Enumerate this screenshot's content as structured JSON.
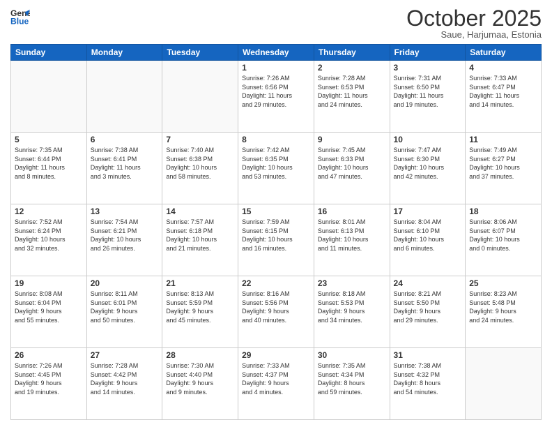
{
  "header": {
    "logo_line1": "General",
    "logo_line2": "Blue",
    "month": "October 2025",
    "location": "Saue, Harjumaa, Estonia"
  },
  "weekdays": [
    "Sunday",
    "Monday",
    "Tuesday",
    "Wednesday",
    "Thursday",
    "Friday",
    "Saturday"
  ],
  "weeks": [
    [
      {
        "day": "",
        "info": ""
      },
      {
        "day": "",
        "info": ""
      },
      {
        "day": "",
        "info": ""
      },
      {
        "day": "1",
        "info": "Sunrise: 7:26 AM\nSunset: 6:56 PM\nDaylight: 11 hours\nand 29 minutes."
      },
      {
        "day": "2",
        "info": "Sunrise: 7:28 AM\nSunset: 6:53 PM\nDaylight: 11 hours\nand 24 minutes."
      },
      {
        "day": "3",
        "info": "Sunrise: 7:31 AM\nSunset: 6:50 PM\nDaylight: 11 hours\nand 19 minutes."
      },
      {
        "day": "4",
        "info": "Sunrise: 7:33 AM\nSunset: 6:47 PM\nDaylight: 11 hours\nand 14 minutes."
      }
    ],
    [
      {
        "day": "5",
        "info": "Sunrise: 7:35 AM\nSunset: 6:44 PM\nDaylight: 11 hours\nand 8 minutes."
      },
      {
        "day": "6",
        "info": "Sunrise: 7:38 AM\nSunset: 6:41 PM\nDaylight: 11 hours\nand 3 minutes."
      },
      {
        "day": "7",
        "info": "Sunrise: 7:40 AM\nSunset: 6:38 PM\nDaylight: 10 hours\nand 58 minutes."
      },
      {
        "day": "8",
        "info": "Sunrise: 7:42 AM\nSunset: 6:35 PM\nDaylight: 10 hours\nand 53 minutes."
      },
      {
        "day": "9",
        "info": "Sunrise: 7:45 AM\nSunset: 6:33 PM\nDaylight: 10 hours\nand 47 minutes."
      },
      {
        "day": "10",
        "info": "Sunrise: 7:47 AM\nSunset: 6:30 PM\nDaylight: 10 hours\nand 42 minutes."
      },
      {
        "day": "11",
        "info": "Sunrise: 7:49 AM\nSunset: 6:27 PM\nDaylight: 10 hours\nand 37 minutes."
      }
    ],
    [
      {
        "day": "12",
        "info": "Sunrise: 7:52 AM\nSunset: 6:24 PM\nDaylight: 10 hours\nand 32 minutes."
      },
      {
        "day": "13",
        "info": "Sunrise: 7:54 AM\nSunset: 6:21 PM\nDaylight: 10 hours\nand 26 minutes."
      },
      {
        "day": "14",
        "info": "Sunrise: 7:57 AM\nSunset: 6:18 PM\nDaylight: 10 hours\nand 21 minutes."
      },
      {
        "day": "15",
        "info": "Sunrise: 7:59 AM\nSunset: 6:15 PM\nDaylight: 10 hours\nand 16 minutes."
      },
      {
        "day": "16",
        "info": "Sunrise: 8:01 AM\nSunset: 6:13 PM\nDaylight: 10 hours\nand 11 minutes."
      },
      {
        "day": "17",
        "info": "Sunrise: 8:04 AM\nSunset: 6:10 PM\nDaylight: 10 hours\nand 6 minutes."
      },
      {
        "day": "18",
        "info": "Sunrise: 8:06 AM\nSunset: 6:07 PM\nDaylight: 10 hours\nand 0 minutes."
      }
    ],
    [
      {
        "day": "19",
        "info": "Sunrise: 8:08 AM\nSunset: 6:04 PM\nDaylight: 9 hours\nand 55 minutes."
      },
      {
        "day": "20",
        "info": "Sunrise: 8:11 AM\nSunset: 6:01 PM\nDaylight: 9 hours\nand 50 minutes."
      },
      {
        "day": "21",
        "info": "Sunrise: 8:13 AM\nSunset: 5:59 PM\nDaylight: 9 hours\nand 45 minutes."
      },
      {
        "day": "22",
        "info": "Sunrise: 8:16 AM\nSunset: 5:56 PM\nDaylight: 9 hours\nand 40 minutes."
      },
      {
        "day": "23",
        "info": "Sunrise: 8:18 AM\nSunset: 5:53 PM\nDaylight: 9 hours\nand 34 minutes."
      },
      {
        "day": "24",
        "info": "Sunrise: 8:21 AM\nSunset: 5:50 PM\nDaylight: 9 hours\nand 29 minutes."
      },
      {
        "day": "25",
        "info": "Sunrise: 8:23 AM\nSunset: 5:48 PM\nDaylight: 9 hours\nand 24 minutes."
      }
    ],
    [
      {
        "day": "26",
        "info": "Sunrise: 7:26 AM\nSunset: 4:45 PM\nDaylight: 9 hours\nand 19 minutes."
      },
      {
        "day": "27",
        "info": "Sunrise: 7:28 AM\nSunset: 4:42 PM\nDaylight: 9 hours\nand 14 minutes."
      },
      {
        "day": "28",
        "info": "Sunrise: 7:30 AM\nSunset: 4:40 PM\nDaylight: 9 hours\nand 9 minutes."
      },
      {
        "day": "29",
        "info": "Sunrise: 7:33 AM\nSunset: 4:37 PM\nDaylight: 9 hours\nand 4 minutes."
      },
      {
        "day": "30",
        "info": "Sunrise: 7:35 AM\nSunset: 4:34 PM\nDaylight: 8 hours\nand 59 minutes."
      },
      {
        "day": "31",
        "info": "Sunrise: 7:38 AM\nSunset: 4:32 PM\nDaylight: 8 hours\nand 54 minutes."
      },
      {
        "day": "",
        "info": ""
      }
    ]
  ]
}
